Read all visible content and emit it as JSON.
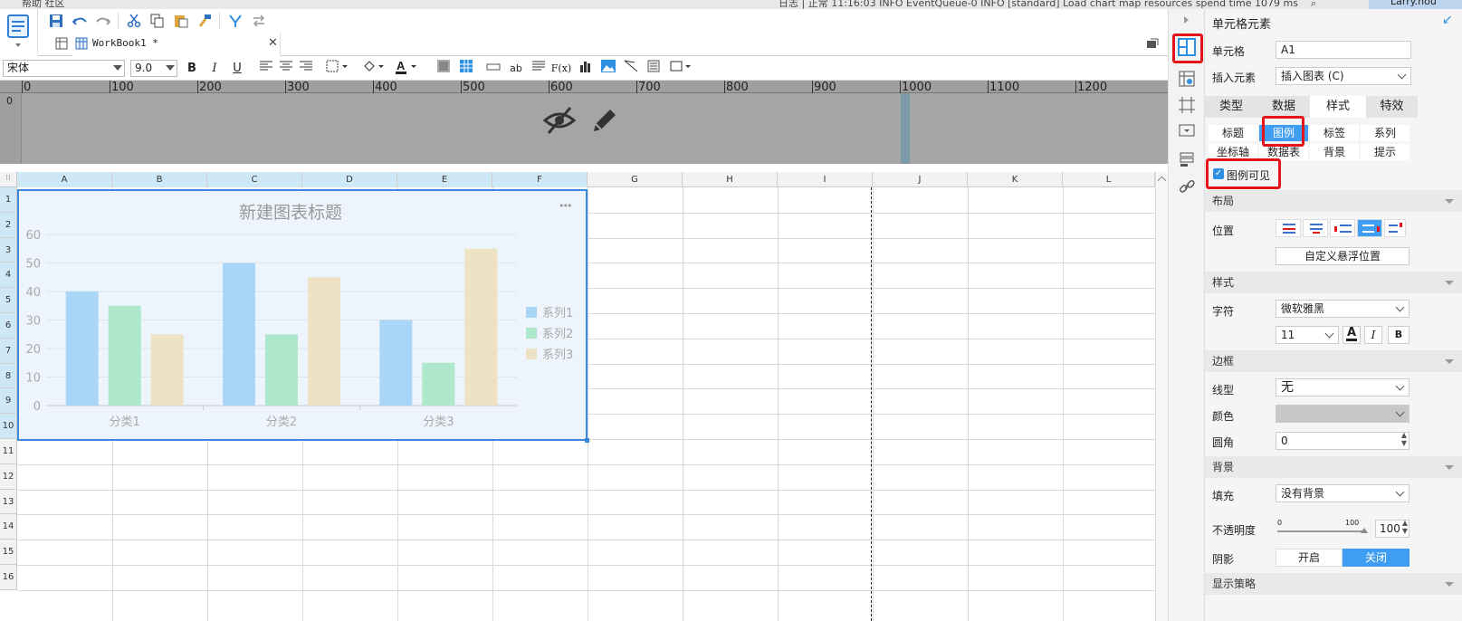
{
  "topbar": {
    "left_text": "帮助    社区",
    "status_text": "日志 | 正常 11:16:03 INFO EventQueue-0 INFO [standard] Load chart map resources spend time 1079 ms",
    "user": "Larry.hou"
  },
  "tabs": {
    "tab_label": "WorkBook1 *"
  },
  "format": {
    "font": "宋体",
    "size": "9.0",
    "bold": "B",
    "italic": "I",
    "underline": "U",
    "ab": "ab",
    "fx": "F(x)"
  },
  "ruler": {
    "ticks": [
      "0",
      "100",
      "200",
      "300",
      "400",
      "500",
      "600",
      "700",
      "800",
      "900",
      "1000",
      "1100",
      "1200"
    ],
    "vlabel": "0"
  },
  "grid": {
    "columns": [
      "A",
      "B",
      "C",
      "D",
      "E",
      "F",
      "G",
      "H",
      "I",
      "J",
      "K",
      "L"
    ],
    "rows": [
      "1",
      "2",
      "3",
      "4",
      "5",
      "6",
      "7",
      "8",
      "9",
      "10",
      "11",
      "12",
      "13",
      "14",
      "15",
      "16"
    ]
  },
  "chart_data": {
    "type": "bar",
    "title": "新建图表标题",
    "categories": [
      "分类1",
      "分类2",
      "分类3"
    ],
    "series": [
      {
        "name": "系列1",
        "values": [
          40,
          50,
          30
        ],
        "color": "#a9d5f7"
      },
      {
        "name": "系列2",
        "values": [
          35,
          25,
          15
        ],
        "color": "#ade8cc"
      },
      {
        "name": "系列3",
        "values": [
          25,
          45,
          55
        ],
        "color": "#ede3c4"
      }
    ],
    "ylim": [
      0,
      60
    ],
    "yticks": [
      "0",
      "10",
      "20",
      "30",
      "40",
      "50",
      "60"
    ],
    "legend": "right",
    "grid": true,
    "menu_glyph": "•••"
  },
  "panel": {
    "title": "单元格元素",
    "cell_label": "单元格",
    "cell_value": "A1",
    "insert_label": "插入元素",
    "insert_value": "插入图表 (C)",
    "main_tabs": [
      "类型",
      "数据",
      "样式",
      "特效"
    ],
    "sub_tabs_row1": [
      "标题",
      "图例",
      "标签",
      "系列"
    ],
    "sub_tabs_row2": [
      "坐标轴",
      "数据表",
      "背景",
      "提示"
    ],
    "legend_visible_label": "图例可见",
    "legend_visible": true,
    "sections": {
      "layout": "布局",
      "style": "样式",
      "border": "边框",
      "background": "背景",
      "strategy": "显示策略"
    },
    "position_label": "位置",
    "custom_float": "自定义悬浮位置",
    "char_label": "字符",
    "font_value": "微软雅黑",
    "font_size": "11",
    "linetype_label": "线型",
    "linetype_value": "无",
    "color_label": "颜色",
    "radius_label": "圆角",
    "radius_value": "0",
    "fill_label": "填充",
    "fill_value": "没有背景",
    "opacity_label": "不透明度",
    "opacity_min": "0",
    "opacity_max": "100",
    "opacity_value": "100",
    "shadow_label": "阴影",
    "shadow_on": "开启",
    "shadow_off": "关闭"
  }
}
